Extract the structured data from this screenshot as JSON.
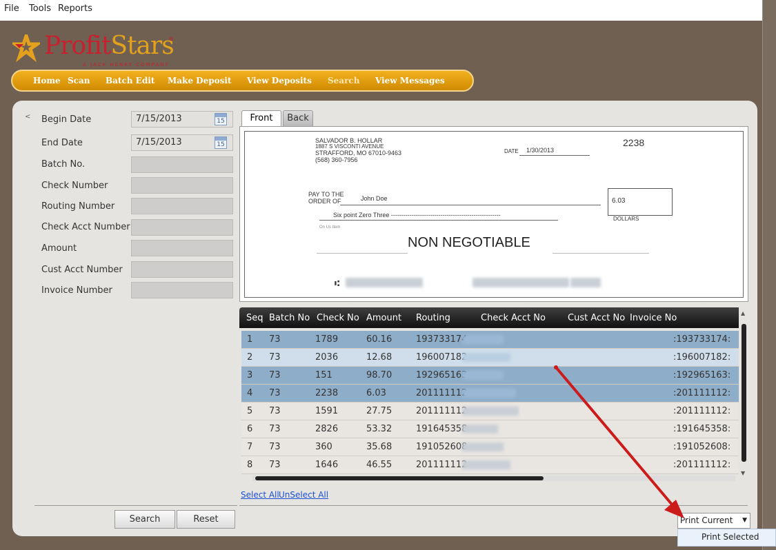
{
  "menu": {
    "file": "File",
    "tools": "Tools",
    "reports": "Reports"
  },
  "logo": {
    "profit": "Profit",
    "stars": "Stars",
    "subtitle": "A JACK HENRY COMPANY",
    "reg": "®"
  },
  "nav": [
    "Home",
    "Scan",
    "Batch Edit",
    "Make Deposit",
    "View Deposits",
    "Search",
    "View Messages"
  ],
  "nav_active": "Search",
  "filters": {
    "begin_date_label": "Begin Date",
    "begin_date_value": "7/15/2013",
    "end_date_label": "End Date",
    "end_date_value": "7/15/2013",
    "batch_no_label": "Batch No.",
    "check_number_label": "Check Number",
    "routing_number_label": "Routing Number",
    "check_acct_label": "Check Acct Number",
    "amount_label": "Amount",
    "cust_acct_label": "Cust Acct Number",
    "invoice_label": "Invoice Number",
    "calendar_icon_text": "15"
  },
  "buttons": {
    "search": "Search",
    "reset": "Reset"
  },
  "tabs": {
    "front": "Front",
    "back": "Back"
  },
  "check": {
    "name": "SALVADOR B. HOLLAR",
    "address1": "1887 S VISCONTI AVENUE",
    "address2": "STRAFFORD, MO 67010-9463",
    "phone": "(568) 360-7956",
    "number": "2238",
    "date_label": "DATE",
    "date": "1/30/2013",
    "pay_to_1": "PAY TO THE",
    "pay_to_2": "ORDER OF",
    "payee": "John Doe",
    "amount": "6.03",
    "amount_words": "Six point Zero Three -----------------------------------------------------",
    "dollars": "DOLLARS",
    "memo_label": "On Us Item",
    "non_negotiable": "NON NEGOTIABLE",
    "micr_symbol": "⑆"
  },
  "grid": {
    "headers": [
      "Seq",
      "Batch No",
      "Check No",
      "Amount",
      "Routing",
      "Check Acct No",
      "Cust Acct No",
      "Invoice No"
    ],
    "rows": [
      {
        "seq": "1",
        "batch": "73",
        "check": "1789",
        "amount": "60.16",
        "routing": "193733174",
        "tail": ":193733174:"
      },
      {
        "seq": "2",
        "batch": "73",
        "check": "2036",
        "amount": "12.68",
        "routing": "196007182",
        "tail": ":196007182:"
      },
      {
        "seq": "3",
        "batch": "73",
        "check": "151",
        "amount": "98.70",
        "routing": "192965163",
        "tail": ":192965163:"
      },
      {
        "seq": "4",
        "batch": "73",
        "check": "2238",
        "amount": "6.03",
        "routing": "201111112",
        "tail": ":201111112:"
      },
      {
        "seq": "5",
        "batch": "73",
        "check": "1591",
        "amount": "27.75",
        "routing": "201111112",
        "tail": ":201111112:"
      },
      {
        "seq": "6",
        "batch": "73",
        "check": "2826",
        "amount": "53.32",
        "routing": "191645358",
        "tail": ":191645358:"
      },
      {
        "seq": "7",
        "batch": "73",
        "check": "360",
        "amount": "35.68",
        "routing": "191052608",
        "tail": ":191052608:"
      },
      {
        "seq": "8",
        "batch": "73",
        "check": "1646",
        "amount": "46.55",
        "routing": "201111112",
        "tail": ":201111112:"
      }
    ]
  },
  "links": {
    "select_all": "Select All",
    "unselect_all": "UnSelect All"
  },
  "print": {
    "current": "Print Current",
    "selected": "Print Selected"
  },
  "colors": {
    "nav_orange": "#e39e0b",
    "brand_red": "#c8202f",
    "selected_row": "#8eadc8",
    "arrow": "#cc1b1b"
  }
}
